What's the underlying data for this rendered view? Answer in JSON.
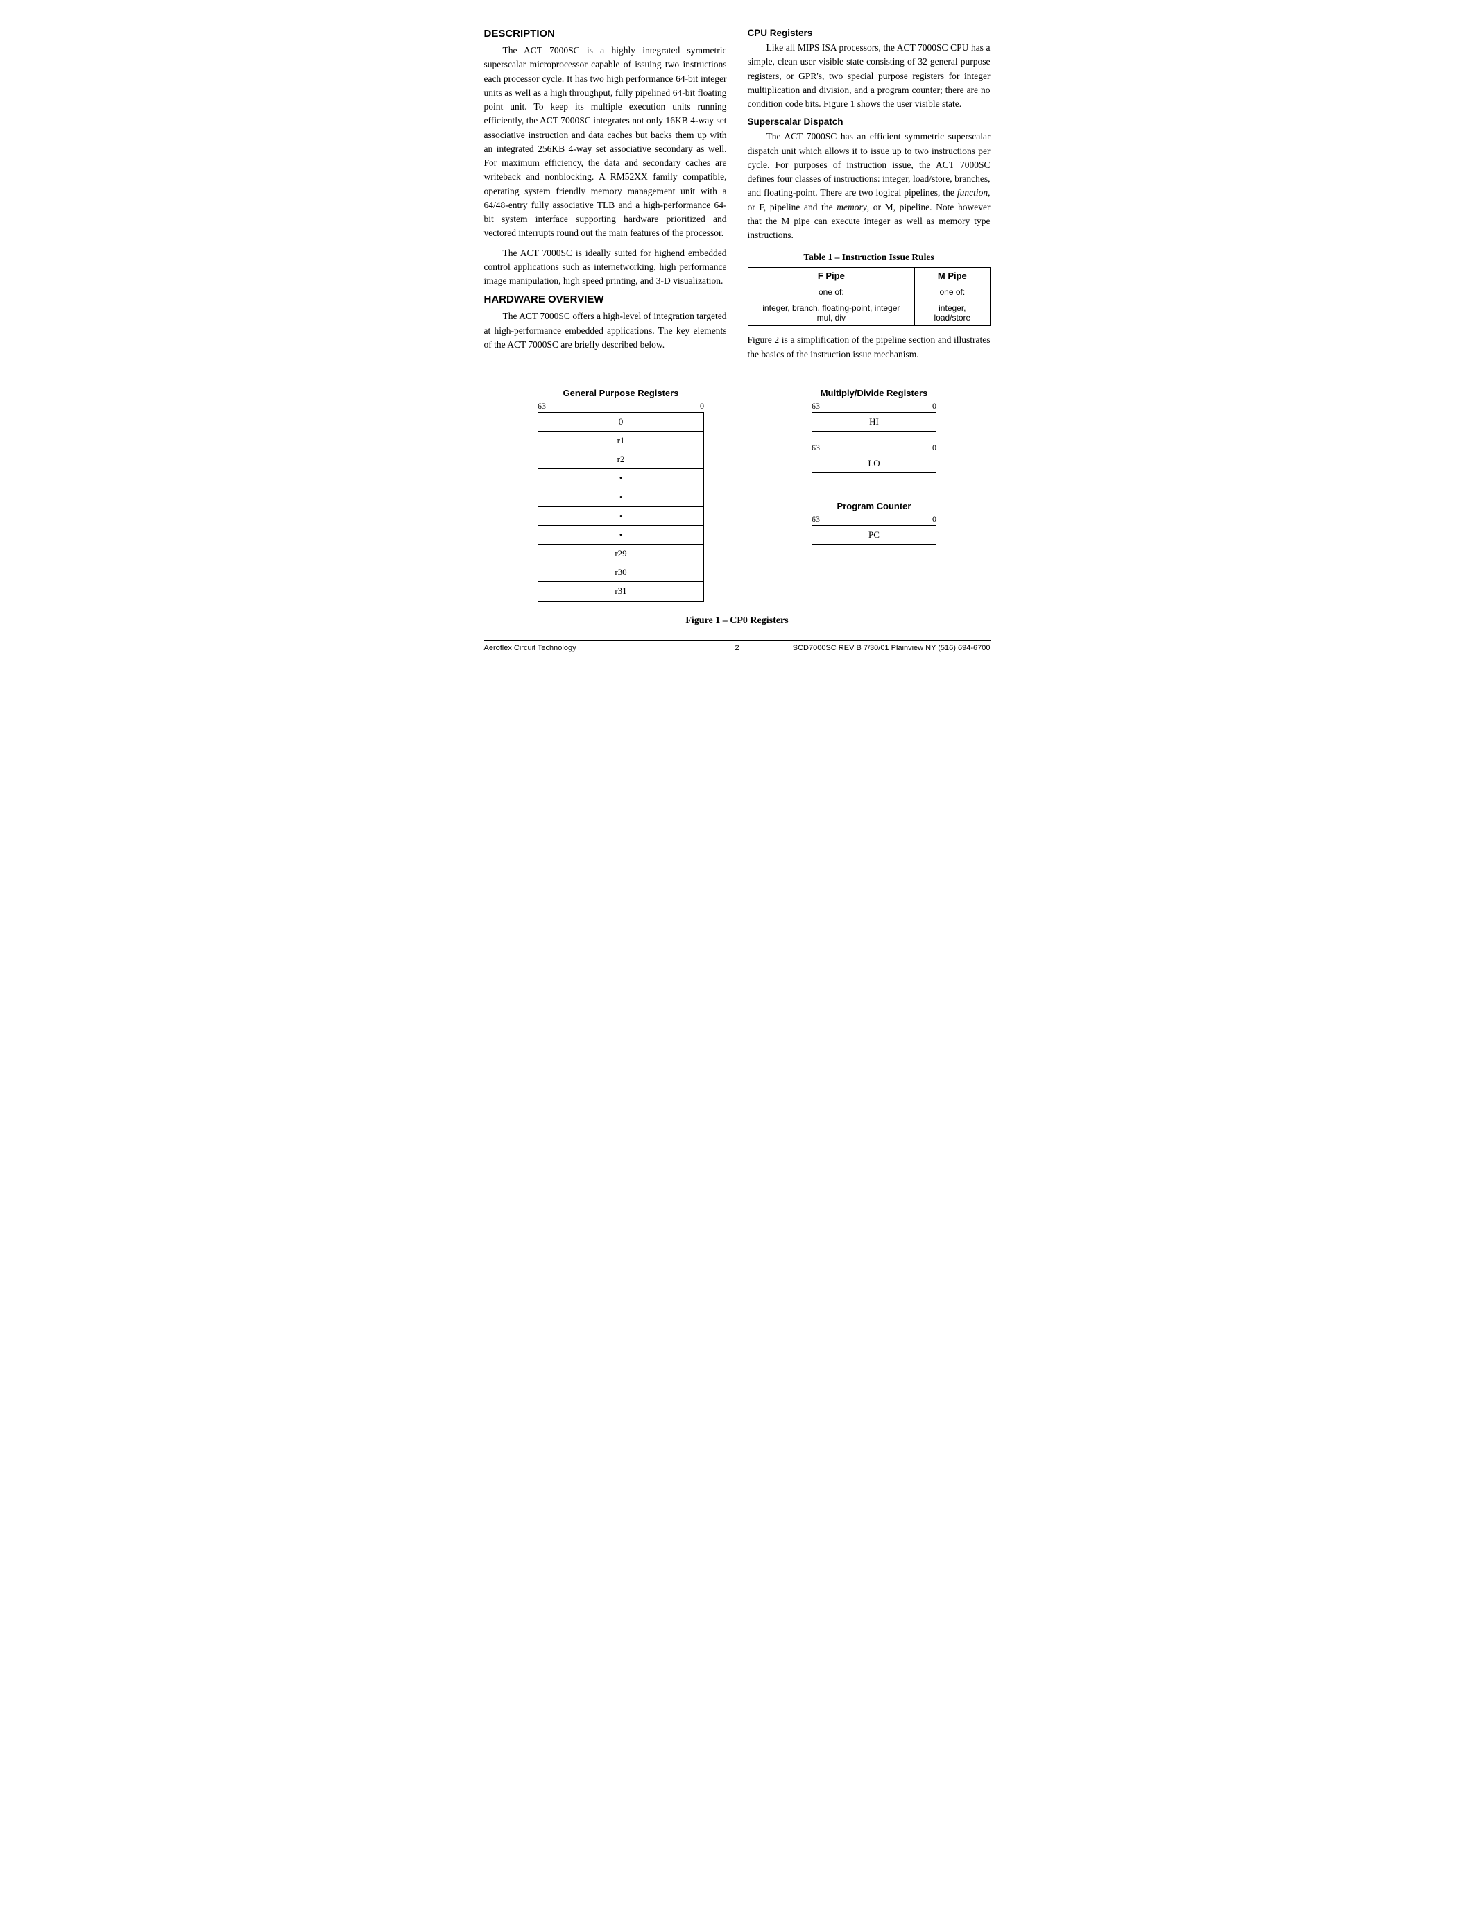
{
  "page": {
    "sections": {
      "description": {
        "title": "DESCRIPTION",
        "paragraphs": [
          "The ACT 7000SC is a highly integrated symmetric superscalar microprocessor capable of issuing two instructions each processor cycle. It has two high performance 64-bit integer units as well as a high throughput, fully pipelined 64-bit floating point unit. To keep its multiple execution units running efficiently, the ACT 7000SC integrates not only 16KB 4-way set associative instruction and data caches but backs them up with an integrated 256KB 4-way set associative secondary as well. For maximum efficiency, the data and secondary caches are writeback and nonblocking. A RM52XX family compatible, operating system friendly memory management unit with a 64/48-entry fully associative TLB and a high-performance 64-bit system interface supporting hardware prioritized and vectored interrupts round out the main features of the processor.",
          "The ACT 7000SC is ideally suited for highend embedded control applications such as internetworking, high performance image manipulation, high speed printing, and 3-D visualization."
        ]
      },
      "hardware_overview": {
        "title": "HARDWARE OVERVIEW",
        "paragraph": "The ACT 7000SC offers a high-level of integration targeted at high-performance embedded applications. The key elements of the ACT 7000SC are briefly described below."
      },
      "cpu_registers": {
        "title": "CPU Registers",
        "paragraph": "Like all MIPS ISA processors, the ACT 7000SC CPU has a simple, clean user visible state consisting of 32 general purpose registers, or GPR's, two special purpose registers for integer multiplication and division, and a program counter; there are no condition code bits. Figure 1 shows the user visible state."
      },
      "superscalar_dispatch": {
        "title": "Superscalar Dispatch",
        "paragraph": "The ACT 7000SC has an efficient symmetric superscalar dispatch unit which allows it to issue up to two instructions per cycle. For purposes of instruction issue, the ACT 7000SC defines four classes of instructions: integer, load/store, branches, and floating-point. There are two logical pipelines, the function, or F, pipeline and the memory, or M, pipeline. Note however that the M pipe can execute integer as well as memory type instructions."
      },
      "table": {
        "title": "Table 1 – Instruction Issue Rules",
        "headers": [
          "F Pipe",
          "M Pipe"
        ],
        "row1": [
          "one of:",
          "one of:"
        ],
        "row2": [
          "integer, branch, floating-point, integer mul, div",
          "integer, load/store"
        ]
      },
      "figure_paragraph": "Figure 2 is a simplification of the pipeline section and illustrates the basics of the instruction issue mechanism."
    },
    "figure": {
      "caption": "Figure 1 – CP0 Registers",
      "gpr": {
        "title": "General Purpose Registers",
        "bit_high": "63",
        "bit_low": "0",
        "rows": [
          "0",
          "r1",
          "r2",
          "•",
          "•",
          "•",
          "•",
          "r29",
          "r30",
          "r31"
        ]
      },
      "multiply_divide": {
        "title": "Multiply/Divide Registers",
        "registers": [
          {
            "bit_high": "63",
            "bit_low": "0",
            "label": "HI"
          },
          {
            "bit_high": "63",
            "bit_low": "0",
            "label": "LO"
          }
        ]
      },
      "program_counter": {
        "title": "Program Counter",
        "bit_high": "63",
        "bit_low": "0",
        "label": "PC"
      }
    },
    "footer": {
      "left": "Aeroflex Circuit Technology",
      "center": "2",
      "right": "SCD7000SC REV B  7/30/01 Plainview NY (516) 694-6700"
    }
  }
}
